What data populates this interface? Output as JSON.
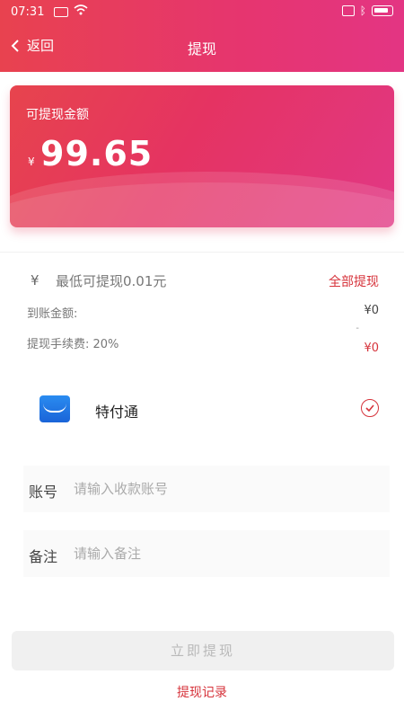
{
  "status_bar": {
    "time": "07:31"
  },
  "nav": {
    "back_label": "返回",
    "title": "提现"
  },
  "balance_card": {
    "label": "可提现金额",
    "currency": "¥",
    "amount": "99.65"
  },
  "withdraw": {
    "currency_symbol": "¥",
    "min_text": "最低可提现0.01元",
    "withdraw_all_label": "全部提现",
    "received_label": "到账金额:",
    "received_value": "¥0",
    "fee_label": "提现手续费: 20%",
    "fee_dash": "-",
    "fee_value": "¥0"
  },
  "payment_method": {
    "name": "特付通",
    "selected": true
  },
  "form": {
    "account_label": "账号",
    "account_placeholder": "请输入收款账号",
    "note_label": "备注",
    "note_placeholder": "请输入备注"
  },
  "actions": {
    "submit_label": "立即提现",
    "records_label": "提现记录"
  },
  "colors": {
    "accent": "#d6333b",
    "header_start": "#e8424f",
    "header_end": "#e33583",
    "pay_logo": "#2a8cf0"
  }
}
